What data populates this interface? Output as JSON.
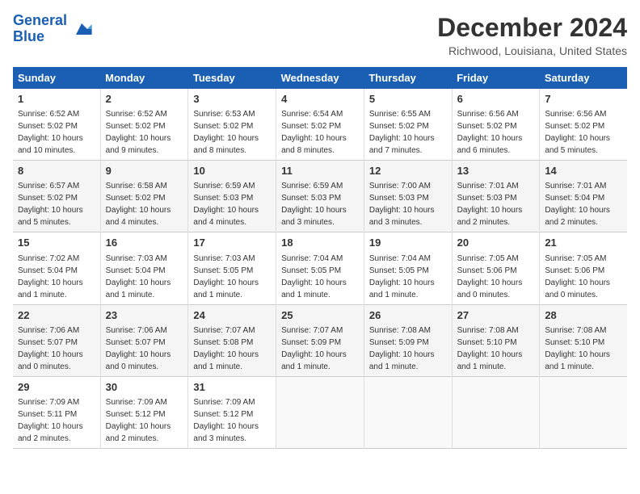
{
  "logo": {
    "line1": "General",
    "line2": "Blue"
  },
  "title": "December 2024",
  "subtitle": "Richwood, Louisiana, United States",
  "days_header": [
    "Sunday",
    "Monday",
    "Tuesday",
    "Wednesday",
    "Thursday",
    "Friday",
    "Saturday"
  ],
  "weeks": [
    [
      {
        "day": "1",
        "info": "Sunrise: 6:52 AM\nSunset: 5:02 PM\nDaylight: 10 hours\nand 10 minutes."
      },
      {
        "day": "2",
        "info": "Sunrise: 6:52 AM\nSunset: 5:02 PM\nDaylight: 10 hours\nand 9 minutes."
      },
      {
        "day": "3",
        "info": "Sunrise: 6:53 AM\nSunset: 5:02 PM\nDaylight: 10 hours\nand 8 minutes."
      },
      {
        "day": "4",
        "info": "Sunrise: 6:54 AM\nSunset: 5:02 PM\nDaylight: 10 hours\nand 8 minutes."
      },
      {
        "day": "5",
        "info": "Sunrise: 6:55 AM\nSunset: 5:02 PM\nDaylight: 10 hours\nand 7 minutes."
      },
      {
        "day": "6",
        "info": "Sunrise: 6:56 AM\nSunset: 5:02 PM\nDaylight: 10 hours\nand 6 minutes."
      },
      {
        "day": "7",
        "info": "Sunrise: 6:56 AM\nSunset: 5:02 PM\nDaylight: 10 hours\nand 5 minutes."
      }
    ],
    [
      {
        "day": "8",
        "info": "Sunrise: 6:57 AM\nSunset: 5:02 PM\nDaylight: 10 hours\nand 5 minutes."
      },
      {
        "day": "9",
        "info": "Sunrise: 6:58 AM\nSunset: 5:02 PM\nDaylight: 10 hours\nand 4 minutes."
      },
      {
        "day": "10",
        "info": "Sunrise: 6:59 AM\nSunset: 5:03 PM\nDaylight: 10 hours\nand 4 minutes."
      },
      {
        "day": "11",
        "info": "Sunrise: 6:59 AM\nSunset: 5:03 PM\nDaylight: 10 hours\nand 3 minutes."
      },
      {
        "day": "12",
        "info": "Sunrise: 7:00 AM\nSunset: 5:03 PM\nDaylight: 10 hours\nand 3 minutes."
      },
      {
        "day": "13",
        "info": "Sunrise: 7:01 AM\nSunset: 5:03 PM\nDaylight: 10 hours\nand 2 minutes."
      },
      {
        "day": "14",
        "info": "Sunrise: 7:01 AM\nSunset: 5:04 PM\nDaylight: 10 hours\nand 2 minutes."
      }
    ],
    [
      {
        "day": "15",
        "info": "Sunrise: 7:02 AM\nSunset: 5:04 PM\nDaylight: 10 hours\nand 1 minute."
      },
      {
        "day": "16",
        "info": "Sunrise: 7:03 AM\nSunset: 5:04 PM\nDaylight: 10 hours\nand 1 minute."
      },
      {
        "day": "17",
        "info": "Sunrise: 7:03 AM\nSunset: 5:05 PM\nDaylight: 10 hours\nand 1 minute."
      },
      {
        "day": "18",
        "info": "Sunrise: 7:04 AM\nSunset: 5:05 PM\nDaylight: 10 hours\nand 1 minute."
      },
      {
        "day": "19",
        "info": "Sunrise: 7:04 AM\nSunset: 5:05 PM\nDaylight: 10 hours\nand 1 minute."
      },
      {
        "day": "20",
        "info": "Sunrise: 7:05 AM\nSunset: 5:06 PM\nDaylight: 10 hours\nand 0 minutes."
      },
      {
        "day": "21",
        "info": "Sunrise: 7:05 AM\nSunset: 5:06 PM\nDaylight: 10 hours\nand 0 minutes."
      }
    ],
    [
      {
        "day": "22",
        "info": "Sunrise: 7:06 AM\nSunset: 5:07 PM\nDaylight: 10 hours\nand 0 minutes."
      },
      {
        "day": "23",
        "info": "Sunrise: 7:06 AM\nSunset: 5:07 PM\nDaylight: 10 hours\nand 0 minutes."
      },
      {
        "day": "24",
        "info": "Sunrise: 7:07 AM\nSunset: 5:08 PM\nDaylight: 10 hours\nand 1 minute."
      },
      {
        "day": "25",
        "info": "Sunrise: 7:07 AM\nSunset: 5:09 PM\nDaylight: 10 hours\nand 1 minute."
      },
      {
        "day": "26",
        "info": "Sunrise: 7:08 AM\nSunset: 5:09 PM\nDaylight: 10 hours\nand 1 minute."
      },
      {
        "day": "27",
        "info": "Sunrise: 7:08 AM\nSunset: 5:10 PM\nDaylight: 10 hours\nand 1 minute."
      },
      {
        "day": "28",
        "info": "Sunrise: 7:08 AM\nSunset: 5:10 PM\nDaylight: 10 hours\nand 1 minute."
      }
    ],
    [
      {
        "day": "29",
        "info": "Sunrise: 7:09 AM\nSunset: 5:11 PM\nDaylight: 10 hours\nand 2 minutes."
      },
      {
        "day": "30",
        "info": "Sunrise: 7:09 AM\nSunset: 5:12 PM\nDaylight: 10 hours\nand 2 minutes."
      },
      {
        "day": "31",
        "info": "Sunrise: 7:09 AM\nSunset: 5:12 PM\nDaylight: 10 hours\nand 3 minutes."
      },
      null,
      null,
      null,
      null
    ]
  ]
}
